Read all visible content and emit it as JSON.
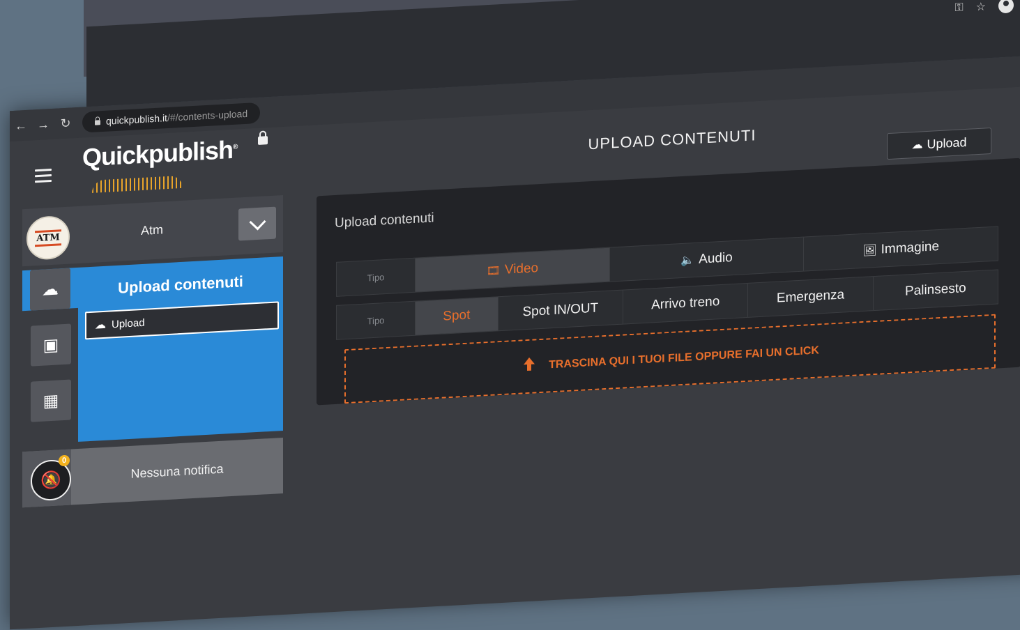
{
  "browser": {
    "url_host": "quickpublish.it",
    "url_path": "/#/contents-upload",
    "nav_back": "←",
    "nav_forward": "→",
    "nav_reload": "↻",
    "icon_key": "⚿",
    "icon_star": "☆"
  },
  "brand": {
    "logo_text": "Quickpublish",
    "logo_mark": "®"
  },
  "account": {
    "logo_text": "ATM",
    "name": "Atm"
  },
  "sidebar": {
    "rail": [
      {
        "icon": "cloud-upload-icon",
        "glyph": "☁"
      },
      {
        "icon": "images-icon",
        "glyph": "▣"
      },
      {
        "icon": "calendar-icon",
        "glyph": "▦"
      }
    ],
    "section_title": "Upload contenuti",
    "subitem_label": "Upload",
    "notifications": {
      "count": "0",
      "text": "Nessuna notifica"
    }
  },
  "main": {
    "page_title": "UPLOAD CONTENUTI",
    "upload_button": "Upload",
    "card_title": "Upload contenuti",
    "row1": {
      "tipo": "Tipo",
      "tabs": [
        "Video",
        "Audio",
        "Immagine"
      ],
      "icons": [
        "film-icon",
        "speaker-icon",
        "image-icon"
      ],
      "active": "Video"
    },
    "row2": {
      "tipo": "Tipo",
      "tabs": [
        "Spot",
        "Spot IN/OUT",
        "Arrivo treno",
        "Emergenza",
        "Palinsesto"
      ],
      "active": "Spot"
    },
    "dropzone_text": "TRASCINA QUI I TUOI FILE OPPURE FAI UN CLICK"
  },
  "colors": {
    "accent_orange": "#e86f2c",
    "accent_blue": "#2a8ad7",
    "background_dark": "#222327"
  }
}
